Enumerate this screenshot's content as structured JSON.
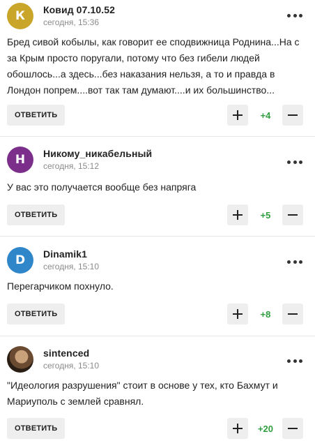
{
  "comments": [
    {
      "avatar_letter": "К",
      "avatar_color": "#c9a52a",
      "author": "Ковид 07.10.52",
      "time": "сегодня, 15:36",
      "text": "Бред сивой кобылы, как говорит ее сподвижница Роднина...На с за Крым просто поругали, потому что без гибели людей обошлось...а здесь...без наказания нельзя, а то и правда в Лондон попрем....вот так там думают....и их большинство...",
      "reply_label": "ОТВЕТИТЬ",
      "score": "+4"
    },
    {
      "avatar_letter": "Н",
      "avatar_color": "#7b2f8a",
      "author": "Никому_никабельный",
      "time": "сегодня, 15:12",
      "text": "У вас это получается вообще без напряга",
      "reply_label": "ОТВЕТИТЬ",
      "score": "+5"
    },
    {
      "avatar_letter": "D",
      "avatar_color": "#2f86c9",
      "author": "Dinamik1",
      "time": "сегодня, 15:10",
      "text": "Перегарчиком похнуло.",
      "reply_label": "ОТВЕТИТЬ",
      "score": "+8"
    },
    {
      "avatar_letter": "",
      "avatar_color": "#6b4a32",
      "author": "sintenced",
      "time": "сегодня, 15:10",
      "text": "\"Идеология разрушения\" стоит в основе у тех, кто Бахмут и Мариуполь с землей сравнял.",
      "reply_label": "ОТВЕТИТЬ",
      "score": "+20"
    }
  ],
  "icons": {
    "more": "more-dots-icon",
    "upvote": "plus-icon",
    "downvote": "minus-icon"
  },
  "colors": {
    "score_positive": "#2e9e3e",
    "button_bg": "#eeeeee"
  }
}
